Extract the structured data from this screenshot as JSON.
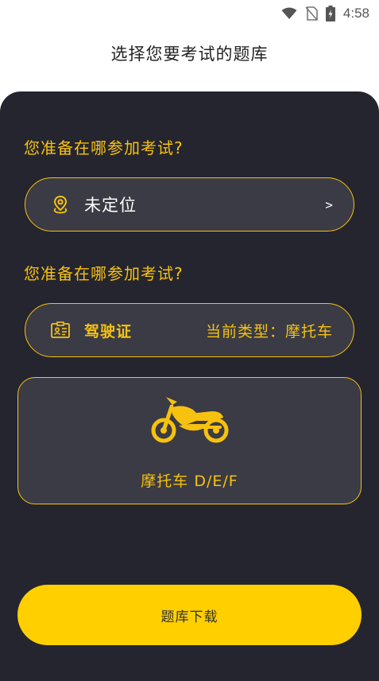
{
  "status_bar": {
    "time": "4:58",
    "icons": [
      "wifi-icon",
      "no-sim-icon",
      "battery-charging-icon"
    ]
  },
  "header": {
    "title": "选择您要考试的题库"
  },
  "location_section": {
    "label": "您准备在哪参加考试?",
    "value": "未定位",
    "icon": "location-pin-icon",
    "arrow": ">"
  },
  "license_section": {
    "label": "您准备在哪参加考试?",
    "license_name": "驾驶证",
    "current_type": "当前类型：摩托车",
    "icon": "id-card-icon"
  },
  "vehicle_card": {
    "icon": "motorcycle-icon",
    "label": "摩托车   D/E/F"
  },
  "download_button": {
    "label": "题库下载"
  },
  "colors": {
    "accent": "#f7c20f",
    "panel_bg": "#25252f",
    "card_bg": "#3b3b45",
    "button_bg": "#ffcf00"
  }
}
